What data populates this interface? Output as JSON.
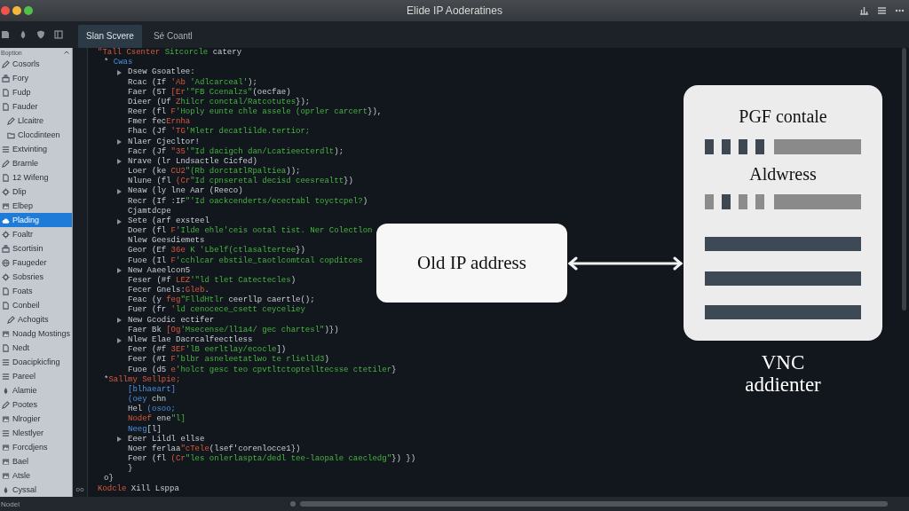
{
  "window": {
    "title": "Elide IP Aoderatines"
  },
  "tabs": [
    {
      "label": "Slan Scvere",
      "selected": true
    },
    {
      "label": "Sé Coantl",
      "selected": false
    }
  ],
  "sidebar": {
    "header": "Boption",
    "items": [
      {
        "label": "Cosorls",
        "kind": "pencil",
        "selected": false
      },
      {
        "label": "Fory",
        "kind": "stack",
        "selected": false
      },
      {
        "label": "Fudp",
        "kind": "page",
        "selected": false
      },
      {
        "label": "Fauder",
        "kind": "page",
        "selected": false,
        "children": [
          {
            "label": "Llcaitre",
            "kind": "pencil",
            "selected": false
          },
          {
            "label": "Clocdinteen",
            "kind": "folder",
            "selected": false
          }
        ]
      },
      {
        "label": "Extvinting",
        "kind": "list",
        "selected": false
      },
      {
        "label": "Brarnle",
        "kind": "pencil",
        "selected": false
      },
      {
        "label": "12 Wifeng",
        "kind": "page",
        "selected": false
      },
      {
        "label": "Dlip",
        "kind": "gear",
        "selected": false
      },
      {
        "label": "Elbep",
        "kind": "image",
        "selected": false
      },
      {
        "label": "Plading",
        "kind": "cloud",
        "selected": true
      },
      {
        "label": "Foaltr",
        "kind": "gear",
        "selected": false
      },
      {
        "label": "Scortisin",
        "kind": "stack",
        "selected": false
      },
      {
        "label": "Faugeder",
        "kind": "globe",
        "selected": false
      },
      {
        "label": "Sobsries",
        "kind": "gear",
        "selected": false
      },
      {
        "label": "Foats",
        "kind": "page",
        "selected": false
      },
      {
        "label": "Conbeil",
        "kind": "page",
        "selected": false,
        "children": [
          {
            "label": "Achogits",
            "kind": "pencil",
            "selected": false
          }
        ]
      },
      {
        "label": "Noadg Mostings",
        "kind": "image",
        "selected": false
      },
      {
        "label": "Nedt",
        "kind": "page",
        "selected": false
      },
      {
        "label": "Doacipkicfing",
        "kind": "list",
        "selected": false
      },
      {
        "label": "Pareel",
        "kind": "list",
        "selected": false
      },
      {
        "label": "Alamie",
        "kind": "drop",
        "selected": false
      },
      {
        "label": "Pootes",
        "kind": "pencil",
        "selected": false
      },
      {
        "label": "Nlrogier",
        "kind": "image",
        "selected": false
      },
      {
        "label": "Nlestlyer",
        "kind": "list",
        "selected": false
      },
      {
        "label": "Forcdjens",
        "kind": "image",
        "selected": false
      },
      {
        "label": "Bael",
        "kind": "image",
        "selected": false
      },
      {
        "label": "Atsle",
        "kind": "image",
        "selected": false
      },
      {
        "label": "Cyssal",
        "kind": "drop",
        "selected": false
      }
    ]
  },
  "editor": {
    "lines": [
      {
        "tokens": [
          {
            "text": "\"Tall",
            "kind": "accent"
          },
          {
            "text": " Csenter",
            "kind": "accent"
          },
          {
            "text": " Sitcorcle",
            "kind": "string"
          },
          {
            "text": " catery",
            "kind": "plain"
          }
        ],
        "foldable": false,
        "children": [
          {
            "tokens": [
              {
                "text": "* ",
                "kind": "plain"
              },
              {
                "text": "Cwas",
                "kind": "name"
              }
            ],
            "foldable": false,
            "children": [
              {
                "tokens": [
                  {
                    "text": "Dsew Gsoatlee:",
                    "kind": "plain"
                  }
                ],
                "foldable": true
              },
              {
                "tokens": [
                  {
                    "text": "Rcac (If ",
                    "kind": "plain"
                  },
                  {
                    "text": "'Ab ",
                    "kind": "accent"
                  },
                  {
                    "text": "'Adlcarceal'",
                    "kind": "string"
                  },
                  {
                    "text": ");",
                    "kind": "plain"
                  }
                ],
                "foldable": false
              },
              {
                "tokens": [
                  {
                    "text": "Faer (5T ",
                    "kind": "plain"
                  },
                  {
                    "text": "[Er",
                    "kind": "accent"
                  },
                  {
                    "text": "'\"FB Ccenalzs\"",
                    "kind": "string"
                  },
                  {
                    "text": "(oecfae)",
                    "kind": "plain"
                  }
                ],
                "foldable": false
              },
              {
                "tokens": [
                  {
                    "text": "Dieer (Uf ",
                    "kind": "plain"
                  },
                  {
                    "text": "Z",
                    "kind": "accent"
                  },
                  {
                    "text": "hilcr conctal/Ratcotutes",
                    "kind": "string"
                  },
                  {
                    "text": "});",
                    "kind": "plain"
                  }
                ],
                "foldable": false
              },
              {
                "tokens": [
                  {
                    "text": "Reer (fl ",
                    "kind": "plain"
                  },
                  {
                    "text": "F",
                    "kind": "accent"
                  },
                  {
                    "text": "'Hoply eunte chle assele (oprler carcert",
                    "kind": "string"
                  },
                  {
                    "text": "}),",
                    "kind": "plain"
                  }
                ],
                "foldable": false
              },
              {
                "tokens": [
                  {
                    "text": "Fmer fec",
                    "kind": "plain"
                  },
                  {
                    "text": "Ernha",
                    "kind": "accent"
                  }
                ],
                "foldable": false
              },
              {
                "tokens": [
                  {
                    "text": "Fhac (Jf ",
                    "kind": "plain"
                  },
                  {
                    "text": "'TG",
                    "kind": "accent"
                  },
                  {
                    "text": "'Mletr decatlilde.tertior;",
                    "kind": "string"
                  }
                ],
                "foldable": false
              },
              {
                "tokens": [
                  {
                    "text": "Nlaer Cjecltor!",
                    "kind": "plain"
                  }
                ],
                "foldable": true
              },
              {
                "tokens": [
                  {
                    "text": "Facr (Jf ",
                    "kind": "plain"
                  },
                  {
                    "text": "\"35",
                    "kind": "accent"
                  },
                  {
                    "text": "'\"Id dacigch dan/Lcatieecterdlt",
                    "kind": "string"
                  },
                  {
                    "text": ");",
                    "kind": "plain"
                  }
                ],
                "foldable": false
              },
              {
                "tokens": [
                  {
                    "text": "Nrave (lr Lndsactle Cicfed)",
                    "kind": "plain"
                  }
                ],
                "foldable": true
              },
              {
                "tokens": [
                  {
                    "text": "Loer (ke ",
                    "kind": "plain"
                  },
                  {
                    "text": "CU2",
                    "kind": "accent"
                  },
                  {
                    "text": "\"(Rb dorctatlRpaltiea",
                    "kind": "string"
                  },
                  {
                    "text": "));",
                    "kind": "plain"
                  }
                ],
                "foldable": false
              },
              {
                "tokens": [
                  {
                    "text": "Nlune (fl ",
                    "kind": "plain"
                  },
                  {
                    "text": "(Cr",
                    "kind": "accent"
                  },
                  {
                    "text": "\"Id cpnseretal decisd ceesrealtt",
                    "kind": "string"
                  },
                  {
                    "text": "})",
                    "kind": "plain"
                  }
                ],
                "foldable": false
              },
              {
                "tokens": [
                  {
                    "text": "Neaw (ly lne Aar (Reeco)",
                    "kind": "plain"
                  }
                ],
                "foldable": true
              },
              {
                "tokens": [
                  {
                    "text": "Recr (If :IF",
                    "kind": "plain"
                  },
                  {
                    "text": "\"'Id oackcenderts/ecectabl toyctcpel?",
                    "kind": "string"
                  },
                  {
                    "text": ")",
                    "kind": "plain"
                  }
                ],
                "foldable": false
              },
              {
                "tokens": [
                  {
                    "text": "Cjamtdcpe",
                    "kind": "plain"
                  }
                ],
                "foldable": false
              },
              {
                "tokens": [
                  {
                    "text": "Sete (arf exsteel",
                    "kind": "plain"
                  }
                ],
                "foldable": true
              },
              {
                "tokens": [
                  {
                    "text": "Doer (fl ",
                    "kind": "plain"
                  },
                  {
                    "text": "F",
                    "kind": "accent"
                  },
                  {
                    "text": "'Ilde ehle'ceis ootal tist. Ner Colectlon",
                    "kind": "string"
                  }
                ],
                "foldable": false
              },
              {
                "tokens": [
                  {
                    "text": "Nlew Geesdiemets",
                    "kind": "plain"
                  }
                ],
                "foldable": false
              },
              {
                "tokens": [
                  {
                    "text": "Geor (Ef ",
                    "kind": "plain"
                  },
                  {
                    "text": "36e",
                    "kind": "accent"
                  },
                  {
                    "text": " K 'Lbelf(ctlasaltertee",
                    "kind": "string"
                  },
                  {
                    "text": "})",
                    "kind": "plain"
                  }
                ],
                "foldable": false
              },
              {
                "tokens": [
                  {
                    "text": "Fuoe (Il ",
                    "kind": "plain"
                  },
                  {
                    "text": "F",
                    "kind": "accent"
                  },
                  {
                    "text": "'cchlcar ebstile_taotlcomtcal copditces",
                    "kind": "string"
                  }
                ],
                "foldable": false
              },
              {
                "tokens": [
                  {
                    "text": "New Aaeelcon5",
                    "kind": "plain"
                  }
                ],
                "foldable": true
              },
              {
                "tokens": [
                  {
                    "text": "Feser (#f ",
                    "kind": "plain"
                  },
                  {
                    "text": "LEZ",
                    "kind": "accent"
                  },
                  {
                    "text": "'\"ld tlet Catectecles",
                    "kind": "string"
                  },
                  {
                    "text": ")",
                    "kind": "plain"
                  }
                ],
                "foldable": false
              },
              {
                "tokens": [
                  {
                    "text": "Fecer Gnels:",
                    "kind": "plain"
                  },
                  {
                    "text": "Gleb",
                    "kind": "accent"
                  },
                  {
                    "text": ".",
                    "kind": "plain"
                  }
                ],
                "foldable": false
              },
              {
                "tokens": [
                  {
                    "text": "Feac (y ",
                    "kind": "plain"
                  },
                  {
                    "text": "feg",
                    "kind": "accent"
                  },
                  {
                    "text": "\"FlldHtlr",
                    "kind": "string"
                  },
                  {
                    "text": " ceerllp caertle();",
                    "kind": "plain"
                  }
                ],
                "foldable": false
              },
              {
                "tokens": [
                  {
                    "text": "Fuer (fr ",
                    "kind": "plain"
                  },
                  {
                    "text": "'",
                    "kind": "accent"
                  },
                  {
                    "text": "ld cenocece_csett ceyceliey",
                    "kind": "string"
                  }
                ],
                "foldable": false
              },
              {
                "tokens": [
                  {
                    "text": "New Gcodic ectifer",
                    "kind": "plain"
                  }
                ],
                "foldable": true
              },
              {
                "tokens": [
                  {
                    "text": "Faer Bk ",
                    "kind": "plain"
                  },
                  {
                    "text": "[Og",
                    "kind": "accent"
                  },
                  {
                    "text": "'Msecense/ll1a4/ gec chartesl\"",
                    "kind": "string"
                  },
                  {
                    "text": ")})",
                    "kind": "plain"
                  }
                ],
                "foldable": false
              },
              {
                "tokens": [
                  {
                    "text": "Nlew Elae Dacrcalfeectless",
                    "kind": "plain"
                  }
                ],
                "foldable": true
              },
              {
                "tokens": [
                  {
                    "text": "Feer (#f ",
                    "kind": "plain"
                  },
                  {
                    "text": "3EF",
                    "kind": "accent"
                  },
                  {
                    "text": "'lB eerltlay/ecocle",
                    "kind": "string"
                  },
                  {
                    "text": "])",
                    "kind": "plain"
                  }
                ],
                "foldable": false
              },
              {
                "tokens": [
                  {
                    "text": "Feer (#I ",
                    "kind": "plain"
                  },
                  {
                    "text": "F",
                    "kind": "accent"
                  },
                  {
                    "text": "'blbr asneleetatlwo te rlielld3",
                    "kind": "string"
                  },
                  {
                    "text": ")",
                    "kind": "plain"
                  }
                ],
                "foldable": false
              },
              {
                "tokens": [
                  {
                    "text": "Fuoe (d5 ",
                    "kind": "plain"
                  },
                  {
                    "text": "e",
                    "kind": "accent"
                  },
                  {
                    "text": "'holct gesc teo cpvtltctoptelltecsse ctetiler",
                    "kind": "string"
                  },
                  {
                    "text": "}",
                    "kind": "plain"
                  }
                ],
                "foldable": false
              }
            ]
          },
          {
            "tokens": [
              {
                "text": "*",
                "kind": "plain"
              },
              {
                "text": "Sallmy",
                "kind": "accent"
              },
              {
                "text": " Sellpie;",
                "kind": "accent"
              }
            ],
            "foldable": false,
            "children": [
              {
                "tokens": [
                  {
                    "text": "[blhaeart]",
                    "kind": "name"
                  }
                ],
                "foldable": false
              },
              {
                "tokens": [
                  {
                    "text": "(oey ",
                    "kind": "name"
                  },
                  {
                    "text": "chn",
                    "kind": "plain"
                  }
                ],
                "foldable": false
              },
              {
                "tokens": [
                  {
                    "text": "Hel ",
                    "kind": "plain"
                  },
                  {
                    "text": "(osoo;",
                    "kind": "name"
                  }
                ],
                "foldable": false
              },
              {
                "tokens": [
                  {
                    "text": "Nodef",
                    "kind": "accent"
                  },
                  {
                    "text": " ene",
                    "kind": "plain"
                  },
                  {
                    "text": "\"l]",
                    "kind": "string"
                  }
                ],
                "foldable": false
              },
              {
                "tokens": [
                  {
                    "text": "Neeg",
                    "kind": "name"
                  },
                  {
                    "text": "[l]",
                    "kind": "plain"
                  }
                ],
                "foldable": false
              },
              {
                "tokens": [
                  {
                    "text": "Eeer Lildl ellse",
                    "kind": "plain"
                  }
                ],
                "foldable": true
              },
              {
                "tokens": [
                  {
                    "text": "Noer ferlaa",
                    "kind": "plain"
                  },
                  {
                    "text": "\"cTele",
                    "kind": "accent"
                  },
                  {
                    "text": "(lsef'corenlocce1})",
                    "kind": "plain"
                  }
                ],
                "foldable": false
              },
              {
                "tokens": [
                  {
                    "text": "Feer (fl ",
                    "kind": "plain"
                  },
                  {
                    "text": "(Cr",
                    "kind": "accent"
                  },
                  {
                    "text": "\"les onlerlaspta/dedl tee-laopale caecledg\"",
                    "kind": "string"
                  },
                  {
                    "text": "}) })",
                    "kind": "plain"
                  }
                ],
                "foldable": false
              },
              {
                "tokens": [
                  {
                    "text": "}",
                    "kind": "plain"
                  }
                ],
                "foldable": false
              }
            ]
          },
          {
            "tokens": [
              {
                "text": "o}",
                "kind": "plain"
              }
            ],
            "foldable": false
          }
        ]
      },
      {
        "gutter": "oo",
        "tokens": [
          {
            "text": "Kodcle",
            "kind": "accent"
          },
          {
            "text": " Xill Lsppa",
            "kind": "plain"
          }
        ],
        "foldable": false
      }
    ]
  },
  "diagram": {
    "source": {
      "label": "Old IP address"
    },
    "card": {
      "rows": [
        {
          "label": "PGF contale",
          "marks": [
            {
              "filled": true
            },
            {
              "filled": true
            },
            {
              "filled": true
            },
            {
              "filled": true
            }
          ]
        },
        {
          "label": "Aldwress",
          "marks": [
            {
              "filled": false
            },
            {
              "filled": true
            },
            {
              "filled": false
            },
            {
              "filled": false
            }
          ]
        }
      ],
      "caption": "VNC addienter"
    }
  },
  "status_bar": {
    "label": "Nodel"
  }
}
